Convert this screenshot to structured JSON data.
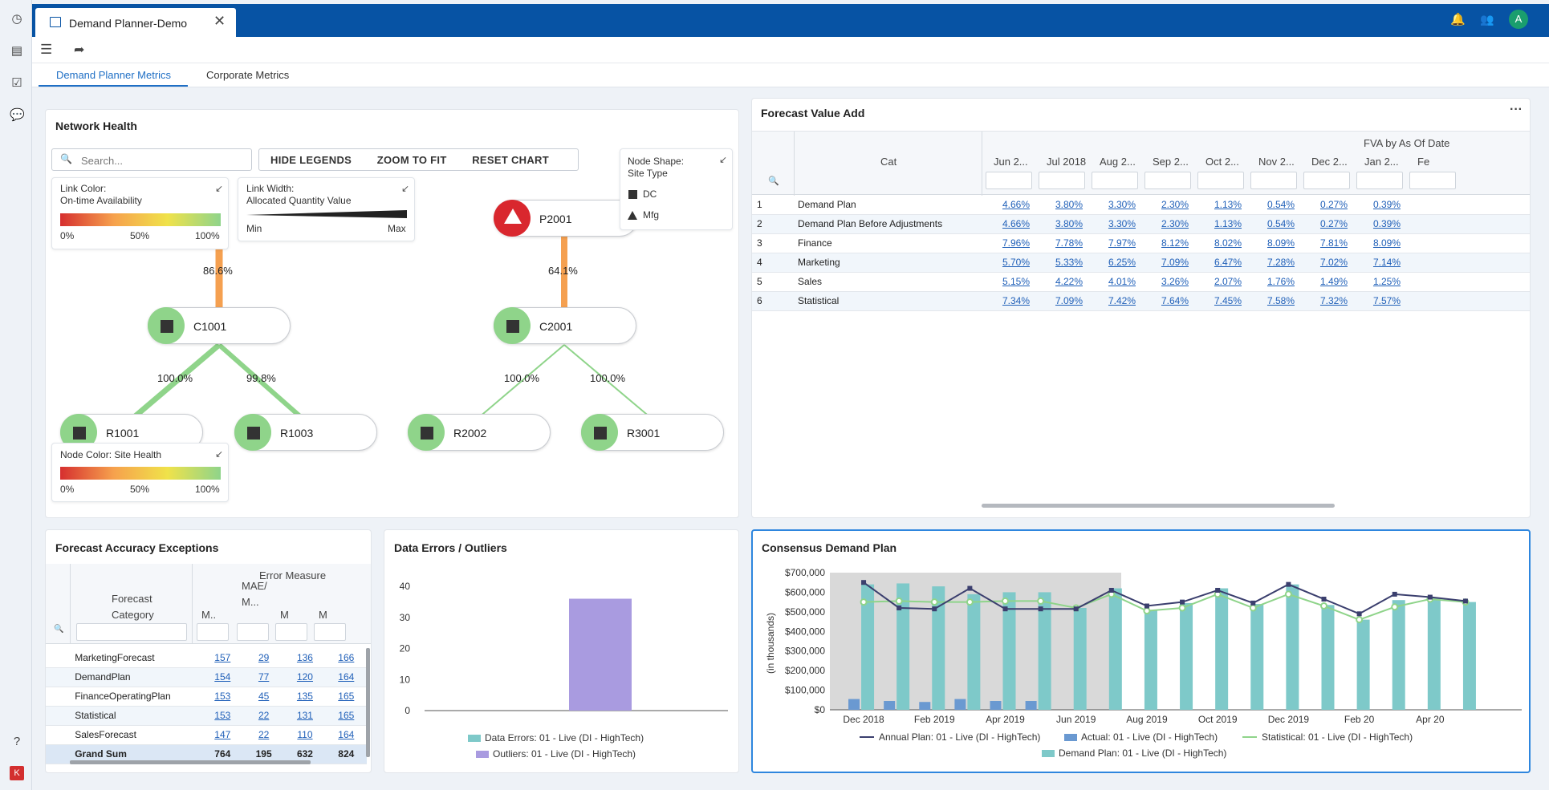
{
  "app": {
    "tab_title": "Demand Planner-Demo",
    "avatar_letter": "A",
    "accent": "#0753a4"
  },
  "page_tabs": [
    "Demand Planner Metrics",
    "Corporate Metrics"
  ],
  "network": {
    "title": "Network Health",
    "search_placeholder": "Search...",
    "buttons": [
      "HIDE LEGENDS",
      "ZOOM TO FIT",
      "RESET CHART"
    ],
    "link_color_legend": {
      "title": "Link Color:",
      "subtitle": "On-time Availability",
      "ticks": [
        "0%",
        "50%",
        "100%"
      ]
    },
    "link_width_legend": {
      "title": "Link Width:",
      "subtitle": "Allocated Quantity Value",
      "min": "Min",
      "max": "Max"
    },
    "node_shape_legend": {
      "title": "Node Shape:",
      "subtitle": "Site Type",
      "items": [
        "DC",
        "Mfg"
      ]
    },
    "node_color_legend": {
      "title": "Node Color: Site Health",
      "ticks": [
        "0%",
        "50%",
        "100%"
      ]
    },
    "nodes": {
      "P2001": "P2001",
      "C1001": "C1001",
      "C2001": "C2001",
      "R1001": "R1001",
      "R1003": "R1003",
      "R2002": "R2002",
      "R3001": "R3001"
    },
    "edge_labels": {
      "to_c1001": "86.6%",
      "to_c2001": "64.1%",
      "c1001_r1001": "100.0%",
      "c1001_r1003": "99.8%",
      "c2001_r2002": "100.0%",
      "c2001_r3001": "100.0%"
    }
  },
  "fva": {
    "title": "Forecast Value Add",
    "group_header": "FVA by As Of Date",
    "cat_header": "Cat",
    "columns": [
      "Jun 2...",
      "Jul 2018",
      "Aug 2...",
      "Sep 2...",
      "Oct 2...",
      "Nov 2...",
      "Dec 2...",
      "Jan 2...",
      "Fe"
    ],
    "rows": [
      {
        "n": "1",
        "cat": "Demand Plan",
        "v": [
          "4.66%",
          "3.80%",
          "3.30%",
          "2.30%",
          "1.13%",
          "0.54%",
          "0.27%",
          "0.39%"
        ]
      },
      {
        "n": "2",
        "cat": "Demand Plan Before Adjustments",
        "v": [
          "4.66%",
          "3.80%",
          "3.30%",
          "2.30%",
          "1.13%",
          "0.54%",
          "0.27%",
          "0.39%"
        ]
      },
      {
        "n": "3",
        "cat": "Finance",
        "v": [
          "7.96%",
          "7.78%",
          "7.97%",
          "8.12%",
          "8.02%",
          "8.09%",
          "7.81%",
          "8.09%"
        ]
      },
      {
        "n": "4",
        "cat": "Marketing",
        "v": [
          "5.70%",
          "5.33%",
          "6.25%",
          "7.09%",
          "6.47%",
          "7.28%",
          "7.02%",
          "7.14%"
        ]
      },
      {
        "n": "5",
        "cat": "Sales",
        "v": [
          "5.15%",
          "4.22%",
          "4.01%",
          "3.26%",
          "2.07%",
          "1.76%",
          "1.49%",
          "1.25%"
        ]
      },
      {
        "n": "6",
        "cat": "Statistical",
        "v": [
          "7.34%",
          "7.09%",
          "7.42%",
          "7.64%",
          "7.45%",
          "7.58%",
          "7.32%",
          "7.57%"
        ]
      }
    ]
  },
  "fae": {
    "title": "Forecast Accuracy Exceptions",
    "group_header": "Error Measure",
    "cat_header_1": "Forecast",
    "cat_header_2": "Category",
    "columns": [
      "M..",
      "MAE/\nM...",
      "M",
      "M"
    ],
    "rows": [
      {
        "cat": "MarketingForecast",
        "v": [
          "157",
          "29",
          "136",
          "166"
        ]
      },
      {
        "cat": "DemandPlan",
        "v": [
          "154",
          "77",
          "120",
          "164"
        ]
      },
      {
        "cat": "FinanceOperatingPlan",
        "v": [
          "153",
          "45",
          "135",
          "165"
        ]
      },
      {
        "cat": "Statistical",
        "v": [
          "153",
          "22",
          "131",
          "165"
        ]
      },
      {
        "cat": "SalesForecast",
        "v": [
          "147",
          "22",
          "110",
          "164"
        ]
      }
    ],
    "total": {
      "cat": "Grand Sum",
      "v": [
        "764",
        "195",
        "632",
        "824"
      ]
    }
  },
  "chart_data": [
    {
      "type": "bar",
      "title": "Data Errors / Outliers",
      "yticks": [
        "40",
        "30",
        "20",
        "10",
        "0"
      ],
      "ylim": [
        0,
        40
      ],
      "series": [
        {
          "name": "Data Errors: 01 - Live (DI - HighTech)",
          "color": "#7ec9c9",
          "values": [
            0
          ]
        },
        {
          "name": "Outliers: 01 - Live (DI - HighTech)",
          "color": "#a99be0",
          "values": [
            36
          ]
        }
      ]
    },
    {
      "type": "bar",
      "title": "Consensus Demand Plan",
      "ylabel": "(in thousands)",
      "yticks": [
        "$700,000",
        "$600,000",
        "$500,000",
        "$400,000",
        "$300,000",
        "$200,000",
        "$100,000",
        "$0"
      ],
      "ylim": [
        0,
        700000
      ],
      "xticks": [
        "Dec 2018",
        "Feb 2019",
        "Apr 2019",
        "Jun 2019",
        "Aug 2019",
        "Oct 2019",
        "Dec 2019",
        "Feb 20",
        "Apr 20"
      ],
      "series": [
        {
          "name": "Annual Plan: 01 - Live (DI - HighTech)",
          "color": "#3b3f6e",
          "values": [
            650000,
            520000,
            515000,
            620000,
            515000,
            515000,
            515000,
            610000,
            530000,
            550000,
            610000,
            545000,
            640000,
            565000,
            490000,
            590000,
            575000,
            555000
          ]
        },
        {
          "name": "Actual: 01 - Live (DI - HighTech)",
          "color": "#6a99d1",
          "values": [
            55000,
            45000,
            40000,
            55000,
            45000,
            45000,
            0,
            0,
            0,
            0,
            0,
            0,
            0,
            0,
            0,
            0,
            0,
            0
          ]
        },
        {
          "name": "Statistical: 01 - Live (DI - HighTech)",
          "color": "#8fd48a",
          "values": [
            550000,
            555000,
            550000,
            550000,
            555000,
            555000,
            520000,
            590000,
            505000,
            520000,
            590000,
            520000,
            590000,
            530000,
            460000,
            525000,
            565000,
            550000
          ]
        },
        {
          "name": "Demand Plan: 01 - Live (DI - HighTech)",
          "color": "#7ec9c9",
          "values": [
            640000,
            645000,
            630000,
            590000,
            600000,
            600000,
            520000,
            620000,
            510000,
            545000,
            620000,
            540000,
            640000,
            535000,
            460000,
            560000,
            570000,
            550000
          ]
        }
      ]
    }
  ]
}
